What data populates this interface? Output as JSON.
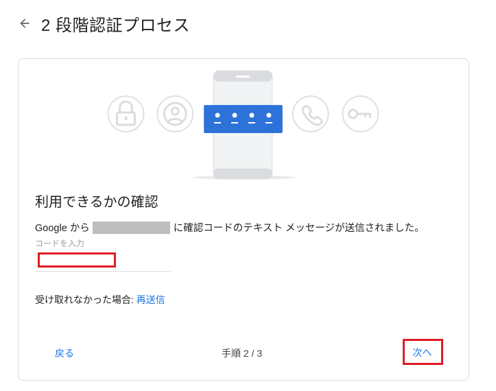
{
  "header": {
    "title": "2 段階認証プロセス",
    "back_icon": "arrow-back-icon"
  },
  "illustration": {
    "icons": [
      "lock-icon",
      "person-icon",
      "phone-call-icon",
      "key-icon"
    ],
    "code_dots": 4,
    "accent": "#2d72d9"
  },
  "card": {
    "heading": "利用できるかの確認",
    "message_prefix": "Google から",
    "message_suffix": "に確認コードのテキスト メッセージが送信されました。",
    "code_label": "コードを入力",
    "code_value": "",
    "resend_prompt": "受け取れなかった場合: ",
    "resend_link": "再送信"
  },
  "footer": {
    "back_label": "戻る",
    "step_text": "手順 2 / 3",
    "next_label": "次へ"
  },
  "colors": {
    "link": "#1a73e8",
    "highlight": "#e01b24",
    "border": "#dadce0"
  }
}
